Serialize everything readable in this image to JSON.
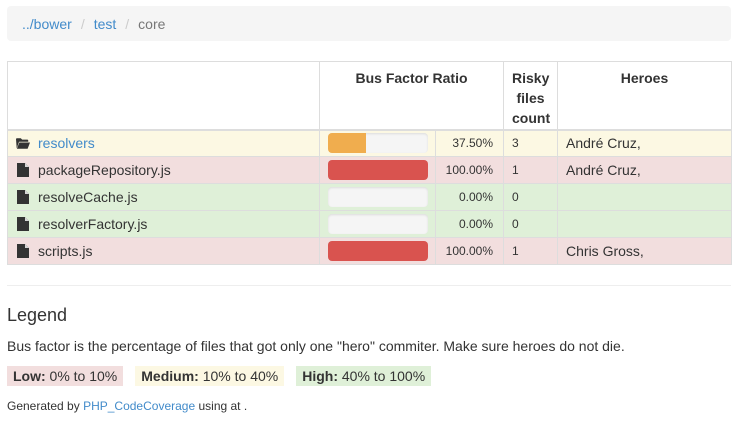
{
  "breadcrumb": {
    "items": [
      "../bower",
      "test",
      "core"
    ],
    "separator": "/"
  },
  "table": {
    "headers": {
      "ratio": "Bus Factor Ratio",
      "risky": [
        "Risky",
        "files",
        "count"
      ],
      "heroes": "Heroes"
    },
    "rows": [
      {
        "type": "folder",
        "name": "resolvers",
        "ratio": 37.5,
        "pct": "37.50%",
        "risky": "3",
        "heroes": "André Cruz,",
        "status": "warning",
        "bar_color": "#f0ad4e",
        "icon": "folder-open-icon"
      },
      {
        "type": "file",
        "name": "packageRepository.js",
        "ratio": 100,
        "pct": "100.00%",
        "risky": "1",
        "heroes": "André Cruz,",
        "status": "danger",
        "bar_color": "#d9534f",
        "icon": "file-icon"
      },
      {
        "type": "file",
        "name": "resolveCache.js",
        "ratio": 0,
        "pct": "0.00%",
        "risky": "0",
        "heroes": "",
        "status": "success",
        "bar_color": "#5cb85c",
        "icon": "file-icon"
      },
      {
        "type": "file",
        "name": "resolverFactory.js",
        "ratio": 0,
        "pct": "0.00%",
        "risky": "0",
        "heroes": "",
        "status": "success",
        "bar_color": "#5cb85c",
        "icon": "file-icon"
      },
      {
        "type": "file",
        "name": "scripts.js",
        "ratio": 100,
        "pct": "100.00%",
        "risky": "1",
        "heroes": "Chris Gross,",
        "status": "danger",
        "bar_color": "#d9534f",
        "icon": "file-icon"
      }
    ]
  },
  "legend": {
    "title": "Legend",
    "description": "Bus factor is the percentage of files that got only one \"hero\" commiter. Make sure heroes do not die.",
    "low": {
      "label": "Low:",
      "range": " 0% to 10%"
    },
    "medium": {
      "label": "Medium:",
      "range": " 10% to 40%"
    },
    "high": {
      "label": "High:",
      "range": " 40% to 100%"
    }
  },
  "footer": {
    "prefix": "Generated by ",
    "link": "PHP_CodeCoverage",
    "suffix": " using at ."
  }
}
